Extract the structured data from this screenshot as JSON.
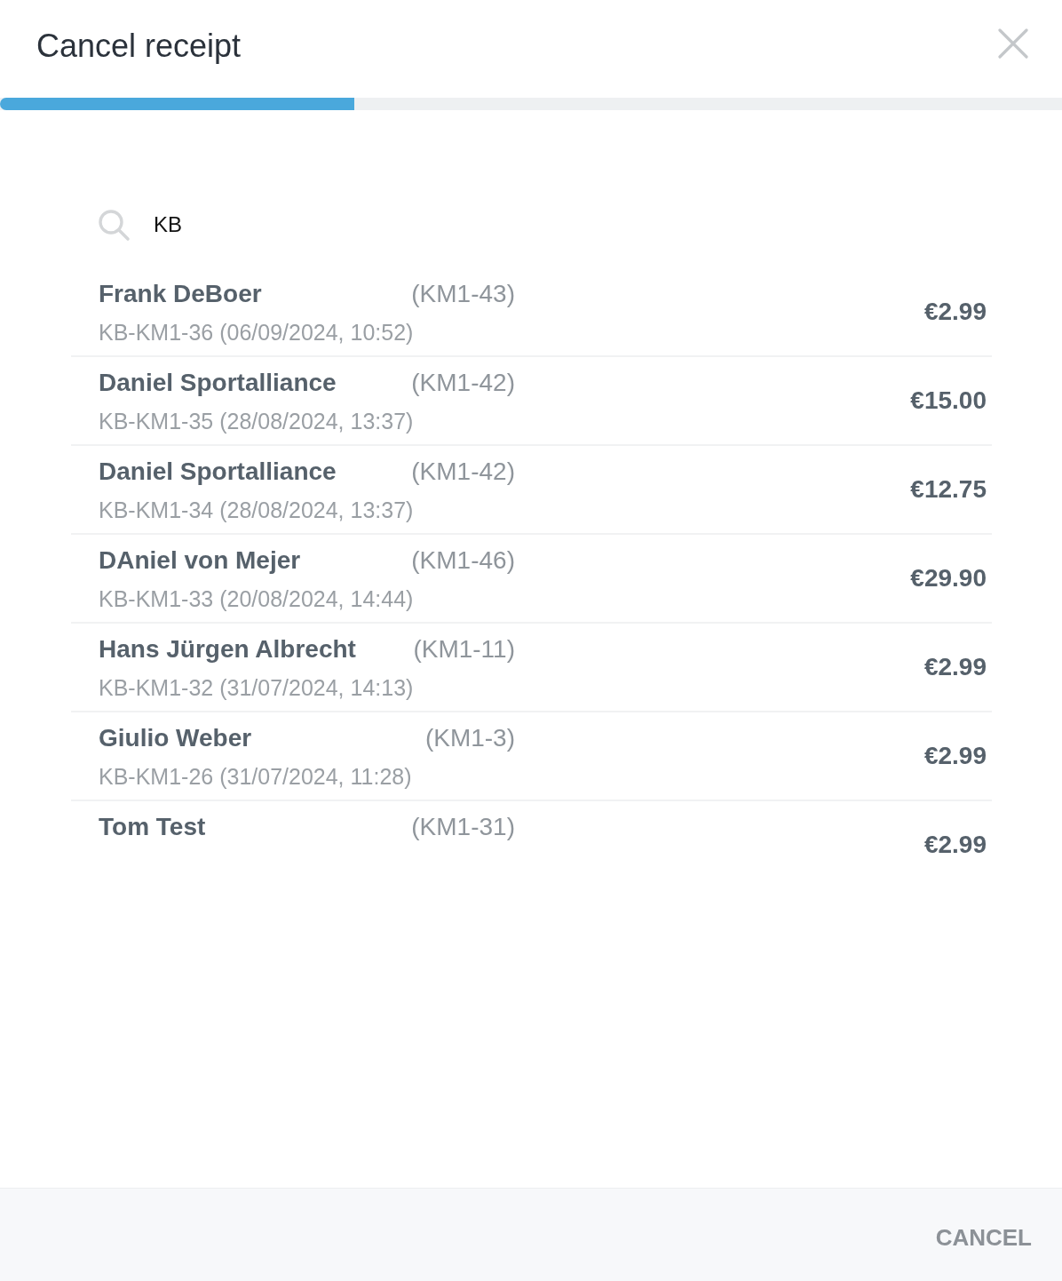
{
  "dialog": {
    "title": "Cancel receipt"
  },
  "progress": {
    "level": 0.334
  },
  "search": {
    "value": "KB"
  },
  "receipts": [
    {
      "name": "Frank DeBoer",
      "customer_id": "(KM1-43)",
      "detail": "KB-KM1-36 (06/09/2024, 10:52)",
      "amount": "€2.99"
    },
    {
      "name": "Daniel Sportalliance",
      "customer_id": "(KM1-42)",
      "detail": "KB-KM1-35 (28/08/2024, 13:37)",
      "amount": "€15.00"
    },
    {
      "name": "Daniel Sportalliance",
      "customer_id": "(KM1-42)",
      "detail": "KB-KM1-34 (28/08/2024, 13:37)",
      "amount": "€12.75"
    },
    {
      "name": "DAniel von Mejer",
      "customer_id": "(KM1-46)",
      "detail": "KB-KM1-33 (20/08/2024, 14:44)",
      "amount": "€29.90"
    },
    {
      "name": "Hans Jürgen Albrecht",
      "customer_id": "(KM1-11)",
      "detail": "KB-KM1-32 (31/07/2024, 14:13)",
      "amount": "€2.99"
    },
    {
      "name": "Giulio Weber",
      "customer_id": "(KM1-3)",
      "detail": "KB-KM1-26 (31/07/2024, 11:28)",
      "amount": "€2.99"
    },
    {
      "name": "Tom Test",
      "customer_id": "(KM1-31)",
      "amount": "€2.99"
    }
  ],
  "footer": {
    "buttons": [
      "CANCEL"
    ]
  }
}
